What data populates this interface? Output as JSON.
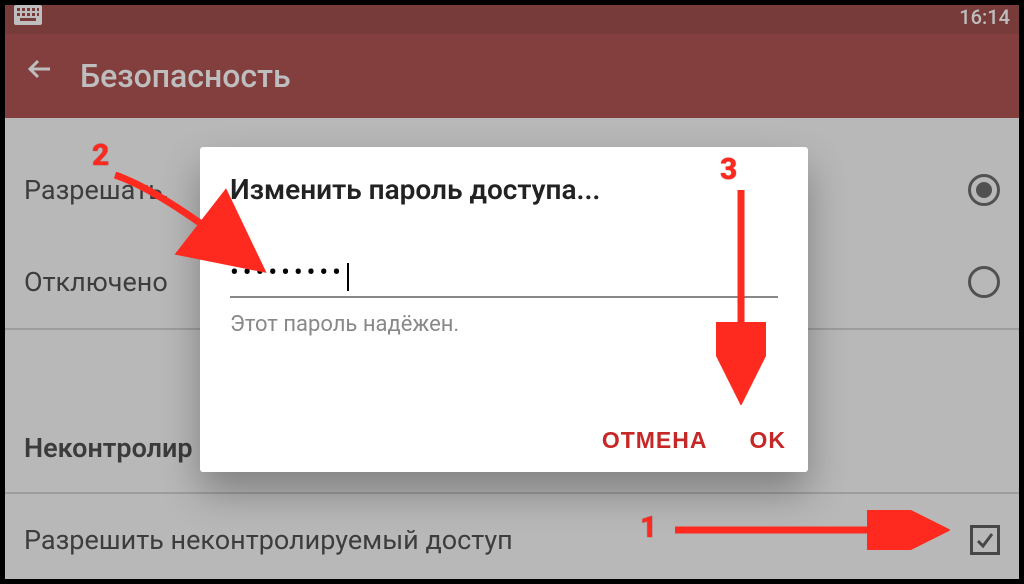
{
  "statusbar": {
    "time": "16:14"
  },
  "appbar": {
    "title": "Безопасность"
  },
  "rows": {
    "truncated_top": " ",
    "allow": "Разрешать,",
    "off": "Отключено",
    "section": "Неконтролир",
    "uncontrolled": "Разрешить неконтролируемый доступ"
  },
  "dialog": {
    "title": "Изменить пароль доступа...",
    "password_mask": "•••••••••",
    "hint": "Этот пароль надёжен.",
    "cancel": "ОТМЕНА",
    "ok": "OK"
  },
  "annotations": {
    "n1": "1",
    "n2": "2",
    "n3": "3"
  }
}
